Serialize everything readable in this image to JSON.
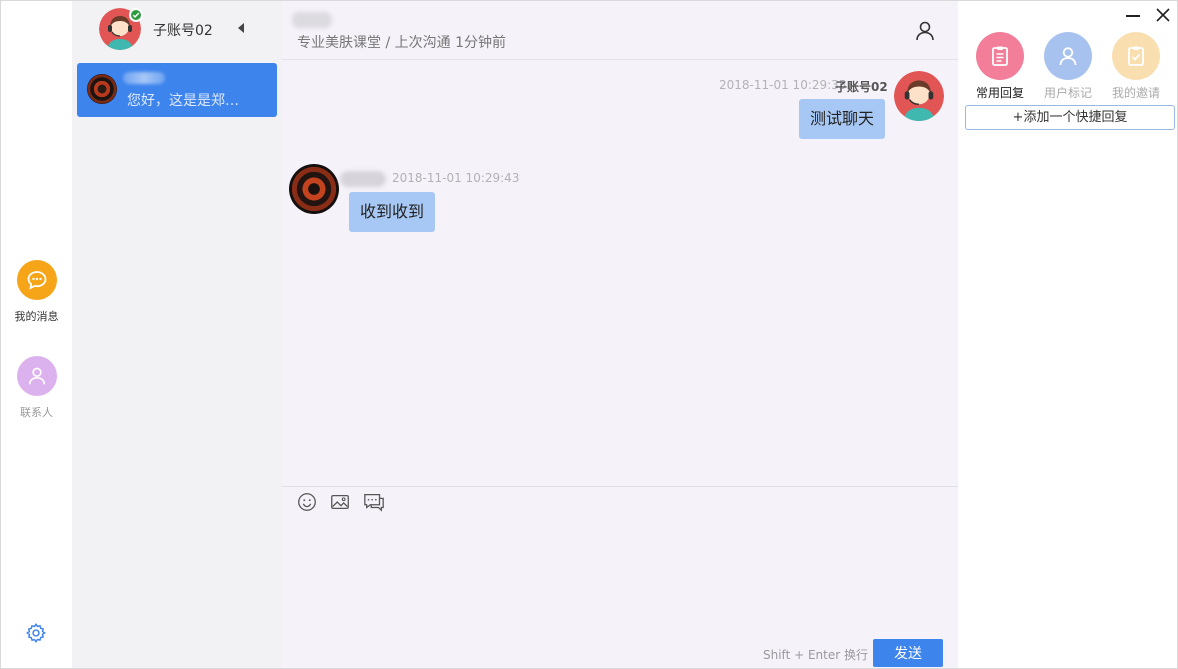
{
  "rail": {
    "items": [
      {
        "label": "我的消息",
        "icon": "chat-bubble-icon",
        "color": "#f6a418"
      },
      {
        "label": "联系人",
        "icon": "contact-person-icon",
        "color": "#dcb2ee"
      }
    ],
    "settings_icon": "gear-icon"
  },
  "me": {
    "name": "子账号02",
    "status": "online"
  },
  "conversations": [
    {
      "preview": "您好，这是是郑…",
      "active": true
    }
  ],
  "chat": {
    "subtitle": "专业美肤课堂 / 上次沟通 1分钟前",
    "messages": [
      {
        "direction": "outgoing",
        "time": "2018-11-01 10:29:35",
        "sender": "子账号02",
        "text": "测试聊天"
      },
      {
        "direction": "incoming",
        "time": "2018-11-01 10:29:43",
        "sender": "",
        "text": "收到收到"
      }
    ],
    "toolbar_icons": [
      "emoji-icon",
      "image-icon",
      "quick-reply-icon"
    ],
    "send_hint": "Shift + Enter 换行",
    "send_label": "发送"
  },
  "right_panel": {
    "tabs": [
      {
        "label": "常用回复",
        "icon": "clipboard-icon",
        "color": "#f27e9a",
        "active": true
      },
      {
        "label": "用户标记",
        "icon": "user-tag-icon",
        "color": "#a8c2f0",
        "active": false
      },
      {
        "label": "我的邀请",
        "icon": "invite-check-icon",
        "color": "#f9deb0",
        "active": false
      }
    ],
    "add_quick_label": "+添加一个快捷回复"
  },
  "colors": {
    "accent": "#3d84ed",
    "bubble": "#a7c8f4",
    "list_bg": "#f2f2f4",
    "chat_bg": "#f5f3f9"
  }
}
